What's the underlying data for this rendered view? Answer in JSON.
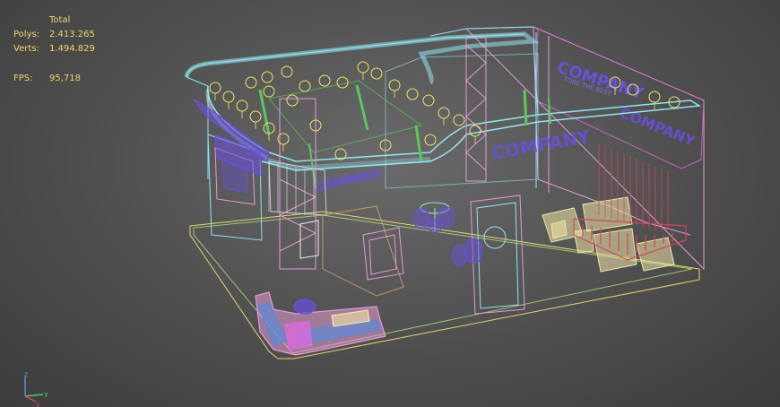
{
  "viewport": {
    "stats": {
      "total_label": "Total",
      "polys_label": "Polys:",
      "polys_value": "2.413.265",
      "verts_label": "Verts:",
      "verts_value": "1.494.829",
      "fps_label": "FPS:",
      "fps_value": "95,718"
    },
    "scene_texts": {
      "sign_front": "COMPANY",
      "sign_back": "COMPANY",
      "sign_upper": "COMPANY",
      "sign_small": "TOBE THE BEST"
    },
    "axis_gizmo": {
      "z_label": "z",
      "x_label": "x",
      "y_label": "y"
    },
    "colors": {
      "background": "#555555",
      "stats_text": "#f3d56a",
      "cyan": "#8fe6f0",
      "pink": "#e59ad6",
      "magenta": "#d76cd8",
      "green": "#59c95d",
      "yellow": "#f2e45e",
      "purple": "#6a4fe0",
      "red": "#d9445a",
      "cream": "#efe6a6"
    }
  }
}
